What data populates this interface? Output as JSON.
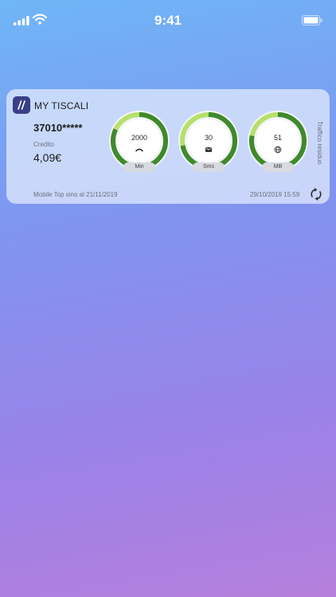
{
  "status_bar": {
    "time": "9:41",
    "icons": [
      "cellular-signal-icon",
      "wifi-icon",
      "battery-icon"
    ]
  },
  "widget": {
    "app_name": "MY TISCALI",
    "logo_icon": "tiscali-logo",
    "phone_number": "37010*****",
    "credit_label": "Credito",
    "credit_value": "4,09€",
    "traffic_label": "Traffico residuo",
    "gauges": [
      {
        "value": "2000",
        "unit": "Min",
        "icon": "phone-handset-icon",
        "level": 0.82
      },
      {
        "value": "30",
        "unit": "Sms",
        "icon": "envelope-icon",
        "level": 0.72
      },
      {
        "value": "51",
        "unit": "MB",
        "icon": "globe-icon",
        "level": 0.78
      }
    ],
    "plan_info": "Mobile Top sino al 21/11/2019",
    "last_update": "29/10/2019 15:59",
    "refresh_icon": "refresh-icon"
  },
  "colors": {
    "gauge_light_green": "#b6e06b",
    "gauge_dark_green": "#3f8a2c",
    "logo_bg": "#3a3f86"
  }
}
